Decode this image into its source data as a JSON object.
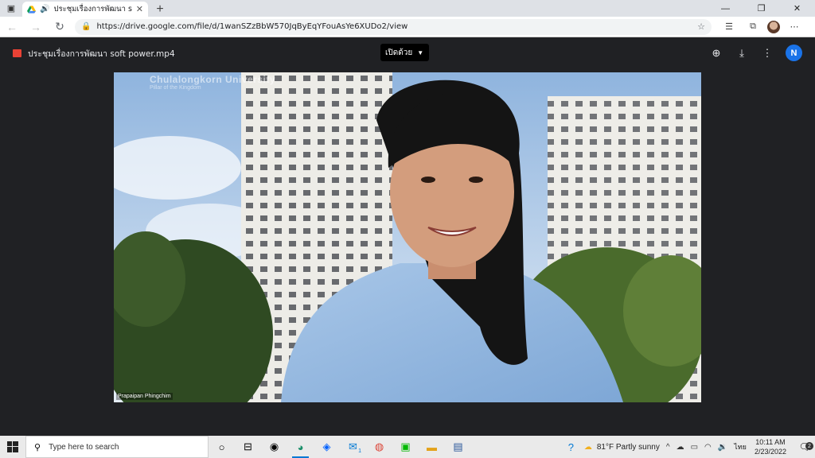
{
  "browser": {
    "tab": {
      "title": "ประชุมเรื่องการพัฒนา soft powe",
      "close_glyph": "✕",
      "audio_glyph": "🔊"
    },
    "new_tab_glyph": "+",
    "window_controls": {
      "minimize": "—",
      "restore": "❐",
      "close": "✕"
    },
    "url": "https://drive.google.com/file/d/1wanSZzBbW570JqByEqYFouAsYe6XUDo2/view"
  },
  "viewer": {
    "file_title": "ประชุมเรื่องการพัฒนา soft power.mp4",
    "open_with_label": "เปิดด้วย",
    "account_initial": "N",
    "file_icon_color": "#e94235",
    "avatar_color": "#1a73e8"
  },
  "video": {
    "watermark_title": "Chulalongkorn University",
    "watermark_subtitle": "Pillar of the Kingdom",
    "speaker_name": "Prapaipan Phingchim"
  },
  "taskbar": {
    "search_placeholder": "Type here to search",
    "weather": "81°F  Partly sunny",
    "language": "ไทย",
    "time": "10:11 AM",
    "date": "2/23/2022",
    "mail_badge": "1",
    "notification_count": "2"
  }
}
